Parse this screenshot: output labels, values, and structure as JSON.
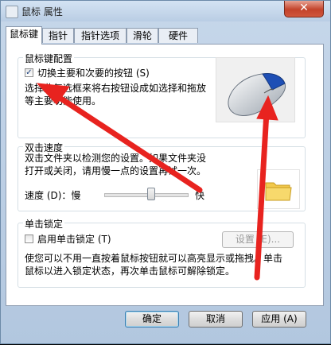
{
  "window": {
    "title": "鼠标 属性",
    "close_glyph": "✕"
  },
  "tabs": [
    "鼠标键",
    "指针",
    "指针选项",
    "滑轮",
    "硬件"
  ],
  "button_config": {
    "group_title": "鼠标键配置",
    "switch_label": "切换主要和次要的按钮 (S)",
    "switch_checked": true,
    "description_line1": "选择此复选框来将右按钮设成如选择和拖放",
    "description_line2": "等主要功能使用。"
  },
  "double_click": {
    "group_title": "双击速度",
    "description_line1": "双击文件夹以检测您的设置。如果文件夹没",
    "description_line2": "打开或关闭，请用慢一点的设置再试一次。",
    "speed_label": "速度 (D)：慢",
    "fast_label": "快",
    "speed_level": 0.56
  },
  "click_lock": {
    "group_title": "单击锁定",
    "enable_label": "启用单击锁定 (T)",
    "enable_checked": false,
    "settings_label": "设置 (E)...",
    "description_line1": "使您可以不用一直按着鼠标按钮就可以高亮显示或拖拽。单击",
    "description_line2": "鼠标以进入锁定状态，再次单击鼠标可解除锁定。"
  },
  "footer": {
    "ok_label": "确定",
    "cancel_label": "取消",
    "apply_label": "应用 (A)"
  },
  "colors": {
    "arrow": "#e8231f",
    "title_bar": "#c4d6ea"
  }
}
